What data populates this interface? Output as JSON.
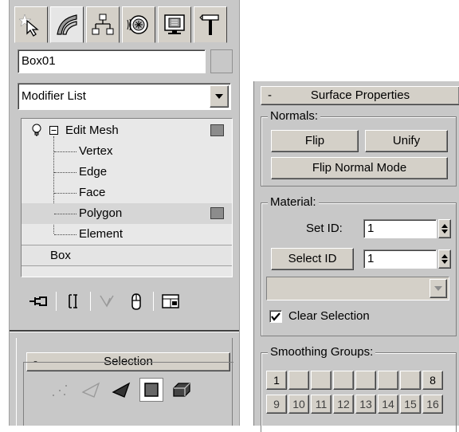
{
  "left_panel": {
    "tabs": [
      {
        "icon": "create-star-cursor-icon"
      },
      {
        "icon": "modify-curve-icon"
      },
      {
        "icon": "hierarchy-icon"
      },
      {
        "icon": "motion-circle-icon"
      },
      {
        "icon": "display-monitor-icon"
      },
      {
        "icon": "utilities-hammer-icon"
      }
    ],
    "object_name": "Box01",
    "modifier_list_label": "Modifier List",
    "stack": {
      "modifier": "Edit Mesh",
      "sublevels": [
        "Vertex",
        "Edge",
        "Face",
        "Polygon",
        "Element"
      ],
      "base_object": "Box"
    },
    "tool_icons": [
      "pin-stack-icon",
      "show-end-result-icon",
      "make-unique-icon",
      "remove-modifier-icon",
      "configure-modifier-sets-icon"
    ],
    "selection_rollout": {
      "title": "Selection",
      "collapse_symbol": "-"
    }
  },
  "right_panel": {
    "title": "Surface Properties",
    "collapse_symbol": "-",
    "normals": {
      "title": "Normals:",
      "flip": "Flip",
      "unify": "Unify",
      "flip_normal_mode": "Flip Normal Mode"
    },
    "material": {
      "title": "Material:",
      "set_id_label": "Set ID:",
      "set_id_value": "1",
      "select_id_button": "Select ID",
      "select_id_value": "1",
      "clear_selection_label": "Clear Selection",
      "clear_selection_checked": true
    },
    "smoothing": {
      "title": "Smoothing Groups:",
      "row1": [
        "1",
        "",
        "",
        "",
        "",
        "",
        "",
        "8"
      ],
      "row2": [
        "9",
        "10",
        "11",
        "12",
        "13",
        "14",
        "15",
        "16"
      ]
    }
  }
}
